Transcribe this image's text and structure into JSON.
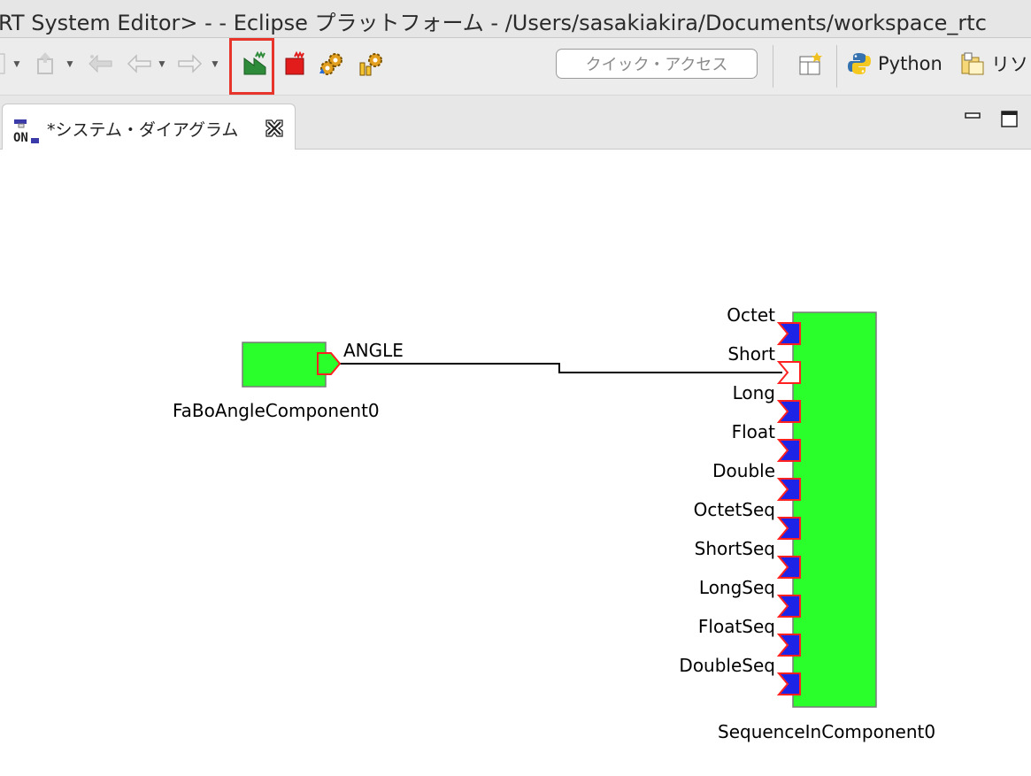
{
  "window": {
    "title": "RT System Editor> -  - Eclipse プラットフォーム - /Users/sasakiakira/Documents/workspace_rtc"
  },
  "toolbar": {
    "quick_access_placeholder": "クイック・アクセス",
    "buttons": [
      {
        "icon": "new-dropdown-icon"
      },
      {
        "icon": "next-annotation-icon"
      },
      {
        "icon": "last-edit-location-icon"
      },
      {
        "icon": "back-icon"
      },
      {
        "icon": "forward-icon"
      },
      {
        "icon": "activate-all-icon",
        "highlighted": true
      },
      {
        "icon": "deactivate-all-icon"
      },
      {
        "icon": "start-all-icon"
      },
      {
        "icon": "stop-all-icon"
      }
    ],
    "perspectives": [
      {
        "icon": "open-perspective-icon",
        "label": ""
      },
      {
        "icon": "python-icon",
        "label": "Python"
      },
      {
        "icon": "resource-icon",
        "label": "リソ"
      }
    ]
  },
  "editor": {
    "tab_label": "*システム・ダイアグラム",
    "tab_icon": "system-diagram-icon"
  },
  "diagram": {
    "components": [
      {
        "name": "FaBoAngleComponent0",
        "color": "#2bff2b",
        "outports": [
          "ANGLE"
        ]
      },
      {
        "name": "SequenceInComponent0",
        "color": "#2bff2b",
        "inports": [
          "Octet",
          "Short",
          "Long",
          "Float",
          "Double",
          "OctetSeq",
          "ShortSeq",
          "LongSeq",
          "FloatSeq",
          "DoubleSeq"
        ]
      }
    ],
    "connections": [
      {
        "from": "FaBoAngleComponent0.ANGLE",
        "to": "SequenceInComponent0.Short"
      }
    ],
    "colors": {
      "port_connected_fill": "#ffffff",
      "port_unconnected_fill": "#1d24e8",
      "port_border": "#ff2020"
    }
  }
}
